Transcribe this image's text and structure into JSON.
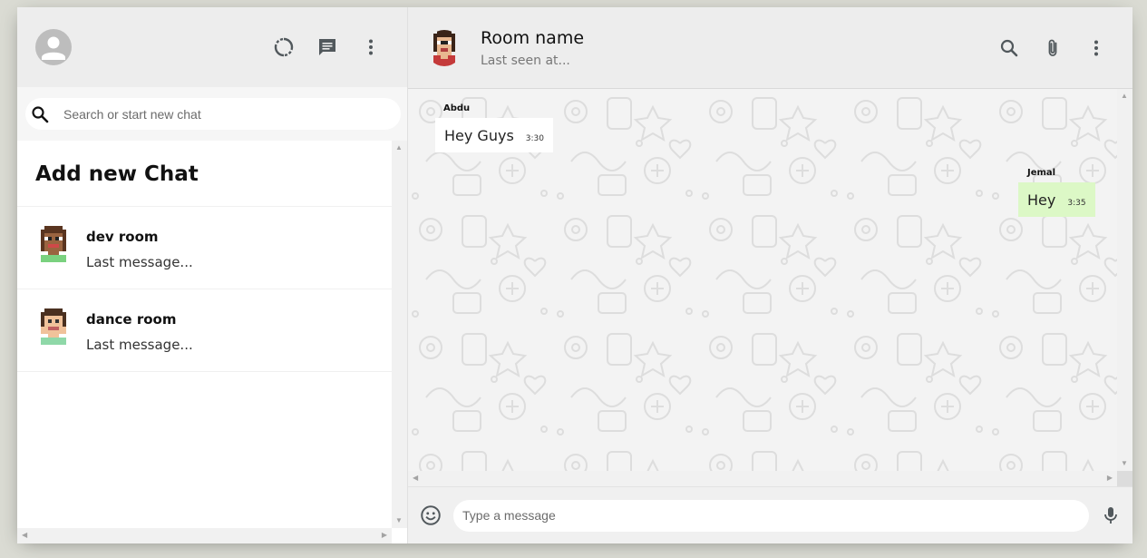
{
  "sidebar": {
    "header": {
      "avatar_icon": "person-icon",
      "icons": [
        "status-icon",
        "new-chat-icon",
        "more-vert-icon"
      ]
    },
    "search": {
      "placeholder": "Search or start new chat",
      "icon": "search-icon"
    },
    "add_chat_label": "Add new Chat",
    "chats": [
      {
        "name": "dev room",
        "last_message": "Last message..."
      },
      {
        "name": "dance room",
        "last_message": "Last message..."
      }
    ]
  },
  "chat": {
    "header": {
      "room_name": "Room name",
      "subtitle": "Last seen at...",
      "icons": [
        "search-icon",
        "attach-icon",
        "more-vert-icon"
      ]
    },
    "messages": [
      {
        "sender": "Abdu",
        "text": "Hey Guys",
        "time": "3:30",
        "mine": false
      },
      {
        "sender": "Jemal",
        "text": "Hey",
        "time": "3:35",
        "mine": true
      }
    ],
    "footer": {
      "placeholder": "Type a message",
      "emoji_icon": "emoji-icon",
      "mic_icon": "mic-icon"
    }
  },
  "colors": {
    "header_bg": "#ededed",
    "sent_bubble": "#dcf8c6",
    "received_bubble": "#ffffff",
    "page_bg": "#dadbd3"
  }
}
